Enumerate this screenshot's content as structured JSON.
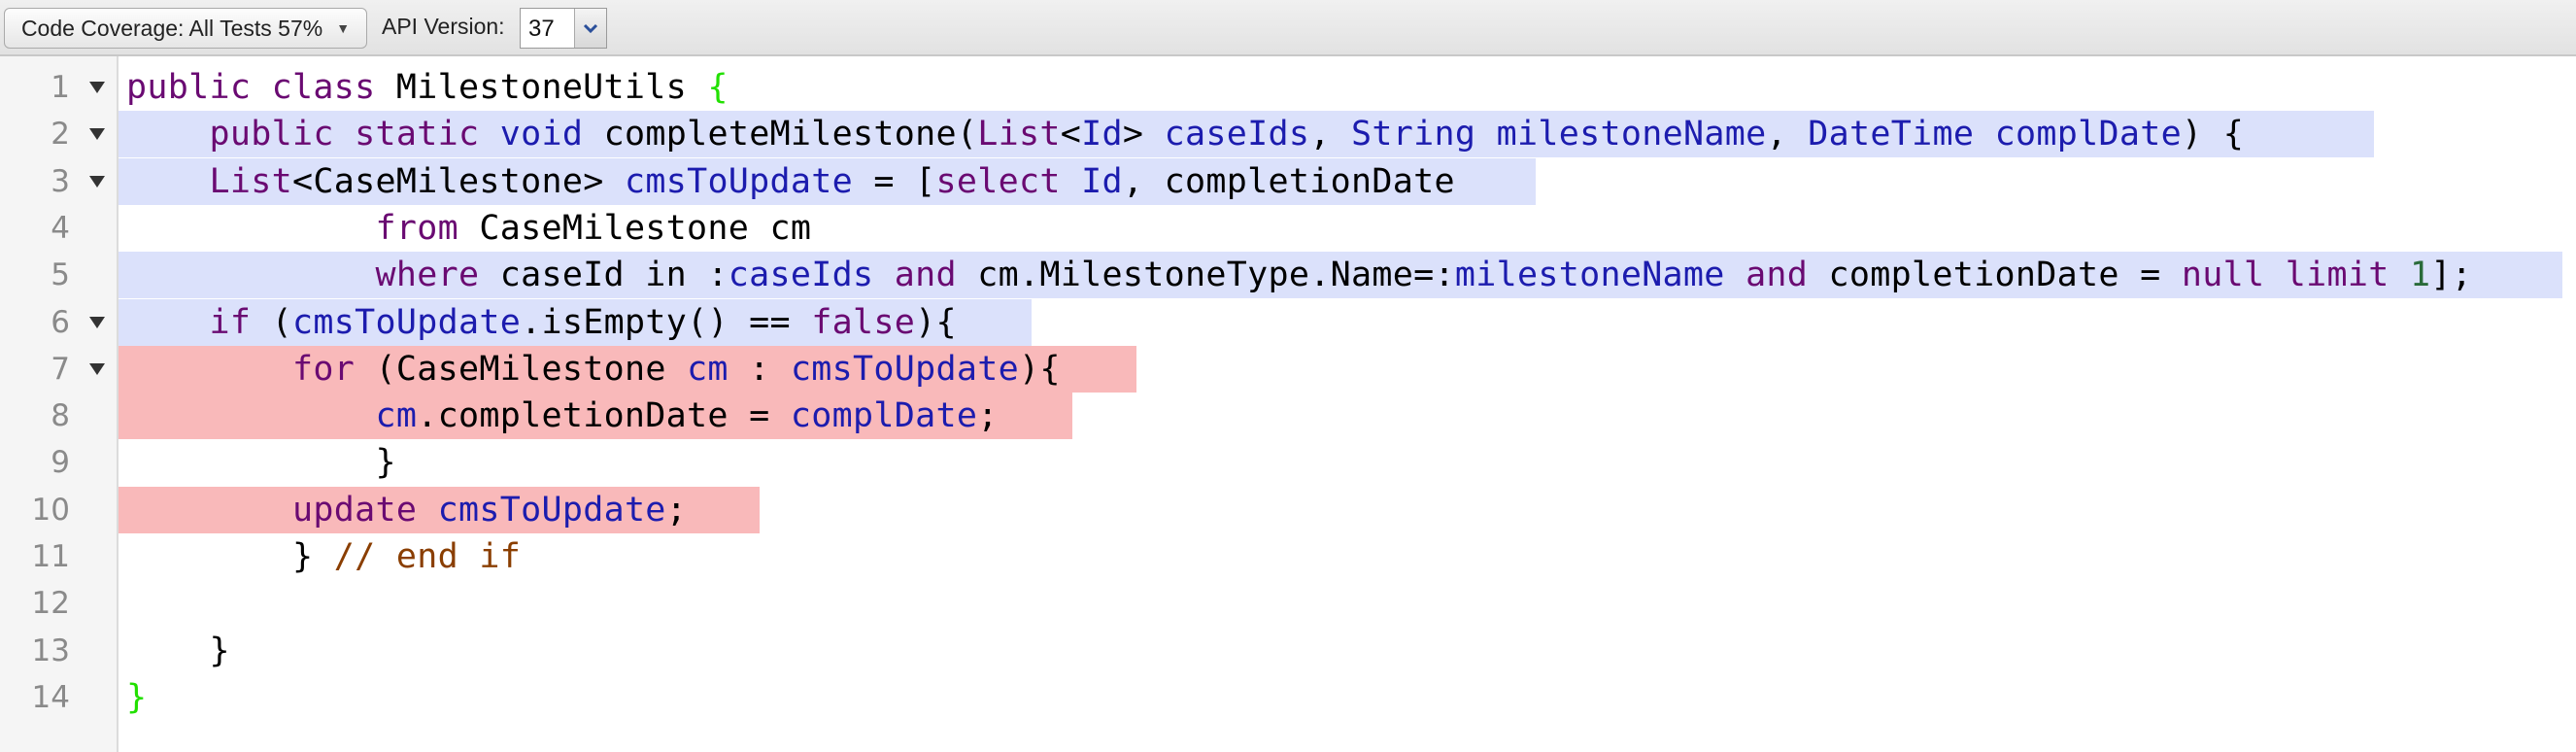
{
  "toolbar": {
    "coverage_label": "Code Coverage: All Tests 57%",
    "api_version_label": "API Version:",
    "api_version_value": "37"
  },
  "colors": {
    "covered": "#dbe1fb",
    "uncovered": "#f9b9ba",
    "keyword": "#6a0a72",
    "identifier": "#1c1cae",
    "comment": "#8a3e00"
  },
  "code_lines": [
    {
      "n": "1",
      "fold": true,
      "coverage": "none",
      "tokens": [
        [
          "public",
          "kw"
        ],
        [
          " ",
          ""
        ],
        [
          "class",
          "kw"
        ],
        [
          " MilestoneUtils ",
          ""
        ],
        [
          "{",
          "br"
        ]
      ]
    },
    {
      "n": "2",
      "fold": true,
      "coverage": "covered",
      "tokens": [
        [
          "    ",
          ""
        ],
        [
          "public",
          "kw"
        ],
        [
          " ",
          ""
        ],
        [
          "static",
          "kw"
        ],
        [
          " ",
          ""
        ],
        [
          "void",
          "id"
        ],
        [
          " completeMilestone(",
          ""
        ],
        [
          "List",
          "kw"
        ],
        [
          "<",
          ""
        ],
        [
          "Id",
          "id"
        ],
        [
          "> ",
          ""
        ],
        [
          "caseIds",
          "id"
        ],
        [
          ", ",
          ""
        ],
        [
          "String",
          "id"
        ],
        [
          " ",
          ""
        ],
        [
          "milestoneName",
          "id"
        ],
        [
          ", ",
          ""
        ],
        [
          "DateTime",
          "id"
        ],
        [
          " ",
          ""
        ],
        [
          "complDate",
          "id"
        ],
        [
          ") {",
          ""
        ]
      ]
    },
    {
      "n": "3",
      "fold": true,
      "coverage": "covered",
      "tokens": [
        [
          "    ",
          ""
        ],
        [
          "List",
          "kw"
        ],
        [
          "<CaseMilestone> ",
          ""
        ],
        [
          "cmsToUpdate",
          "id"
        ],
        [
          " = [",
          ""
        ],
        [
          "select",
          "kw"
        ],
        [
          " ",
          ""
        ],
        [
          "Id",
          "id"
        ],
        [
          ", completionDate",
          ""
        ]
      ]
    },
    {
      "n": "4",
      "fold": false,
      "coverage": "none",
      "tokens": [
        [
          "            ",
          ""
        ],
        [
          "from",
          "kw"
        ],
        [
          " CaseMilestone cm",
          ""
        ]
      ]
    },
    {
      "n": "5",
      "fold": false,
      "coverage": "covered",
      "tokens": [
        [
          "            ",
          ""
        ],
        [
          "where",
          "kw"
        ],
        [
          " caseId in :",
          ""
        ],
        [
          "caseIds",
          "id"
        ],
        [
          " ",
          ""
        ],
        [
          "and",
          "kw"
        ],
        [
          " cm.MilestoneType.Name=:",
          ""
        ],
        [
          "milestoneName",
          "id"
        ],
        [
          " ",
          ""
        ],
        [
          "and",
          "kw"
        ],
        [
          " completionDate = ",
          ""
        ],
        [
          "null",
          "kw"
        ],
        [
          " ",
          ""
        ],
        [
          "limit",
          "kw"
        ],
        [
          " ",
          ""
        ],
        [
          "1",
          "num"
        ],
        [
          "];",
          ""
        ]
      ]
    },
    {
      "n": "6",
      "fold": true,
      "coverage": "covered",
      "tokens": [
        [
          "    ",
          ""
        ],
        [
          "if",
          "kw"
        ],
        [
          " (",
          ""
        ],
        [
          "cmsToUpdate",
          "id"
        ],
        [
          ".isEmpty() == ",
          ""
        ],
        [
          "false",
          "kw"
        ],
        [
          "){",
          ""
        ]
      ]
    },
    {
      "n": "7",
      "fold": true,
      "coverage": "uncovered",
      "tokens": [
        [
          "        ",
          ""
        ],
        [
          "for",
          "kw"
        ],
        [
          " (CaseMilestone ",
          ""
        ],
        [
          "cm",
          "id"
        ],
        [
          " : ",
          ""
        ],
        [
          "cmsToUpdate",
          "id"
        ],
        [
          "){",
          ""
        ]
      ]
    },
    {
      "n": "8",
      "fold": false,
      "coverage": "uncovered",
      "tokens": [
        [
          "            ",
          ""
        ],
        [
          "cm",
          "id"
        ],
        [
          ".completionDate = ",
          ""
        ],
        [
          "complDate",
          "id"
        ],
        [
          ";",
          ""
        ]
      ]
    },
    {
      "n": "9",
      "fold": false,
      "coverage": "none",
      "tokens": [
        [
          "            }",
          ""
        ]
      ]
    },
    {
      "n": "10",
      "fold": false,
      "coverage": "uncovered",
      "tokens": [
        [
          "        ",
          ""
        ],
        [
          "update",
          "kw"
        ],
        [
          " ",
          ""
        ],
        [
          "cmsToUpdate",
          "id"
        ],
        [
          ";",
          ""
        ]
      ]
    },
    {
      "n": "11",
      "fold": false,
      "coverage": "none",
      "tokens": [
        [
          "        } ",
          ""
        ],
        [
          "// end if",
          "cm"
        ]
      ]
    },
    {
      "n": "12",
      "fold": false,
      "coverage": "none",
      "tokens": []
    },
    {
      "n": "13",
      "fold": false,
      "coverage": "none",
      "tokens": [
        [
          "    }",
          ""
        ]
      ]
    },
    {
      "n": "14",
      "fold": false,
      "coverage": "none",
      "tokens": [
        [
          "}",
          "br"
        ]
      ]
    }
  ]
}
